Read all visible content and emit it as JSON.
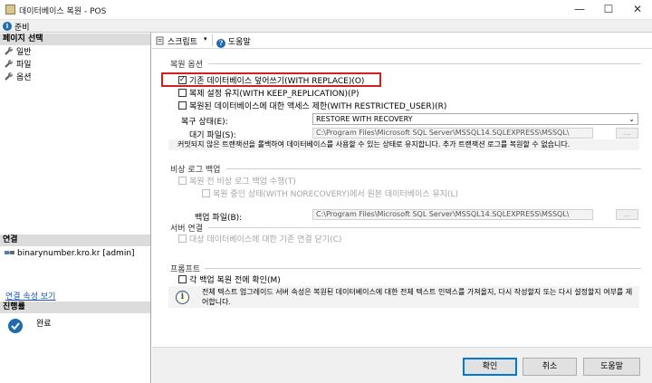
{
  "window": {
    "title": "데이터베이스 복원 - POS",
    "minimize": "—",
    "maximize": "☐",
    "close": "✕"
  },
  "status": {
    "text": "준비"
  },
  "left": {
    "select_page_header": "페이지 선택",
    "pages": [
      "일반",
      "파일",
      "옵션"
    ],
    "connection_header": "연결",
    "connection_text": "binarynumber.kro.kr [admin]",
    "connection_link": "연결 속성 보기",
    "progress_header": "진행률",
    "progress_text": "완료"
  },
  "toolbar": {
    "script_label": "스크립트",
    "help_label": "도움말"
  },
  "restore_options": {
    "group_label": "복원 옵션",
    "overwrite": "기존 데이터베이스 덮어쓰기(WITH REPLACE)(O)",
    "overwrite_checked": true,
    "keep_replication": "복제 설정 유지(WITH KEEP_REPLICATION)(P)",
    "restricted_user": "복원된 데이터베이스에 대한 액세스 제한(WITH RESTRICTED_USER)(R)",
    "recovery_state_label": "복구 상태(E):",
    "recovery_state_value": "RESTORE WITH RECOVERY",
    "standby_file_label": "대기 파일(S):",
    "standby_file_value": "C:\\Program Files\\Microsoft SQL Server\\MSSQL14.SQLEXPRESS\\MSSQL\\",
    "recovery_note": "커밋되지 않은 트랜잭션을 롤백하여 데이터베이스를 사용할 수 있는 상태로 유지합니다. 추가 트랜잭션 로그를 복원할 수 없습니다.",
    "ellipsis": "..."
  },
  "tail_log": {
    "group_label": "비상 로그 백업",
    "take_tail_log": "복원 전 비상 로그 백업 수행(T)",
    "norecovery": "복원 중인 상태(WITH NORECOVERY)에서 원본 데이터베이스 유지(L)",
    "backup_file_label": "백업 파일(B):",
    "backup_file_value": "C:\\Program Files\\Microsoft SQL Server\\MSSQL14.SQLEXPRESS\\MSSQL\\"
  },
  "server_connections": {
    "group_label": "서버 연결",
    "close_existing": "대상 데이터베이스에 대한 기존 연결 닫기(C)"
  },
  "prompt": {
    "group_label": "프롬프트",
    "prompt_before": "각 백업 복원 전에 확인(M)",
    "info_text": "전체 텍스트 업그레이드 서버 속성은 복원된 데이터베이스에 대한 전체 텍스트 인덱스를 가져올지, 다시 작성할지 또는 다시 설정할지 여부를 제어합니다."
  },
  "buttons": {
    "ok": "확인",
    "cancel": "취소",
    "help": "도움말"
  }
}
